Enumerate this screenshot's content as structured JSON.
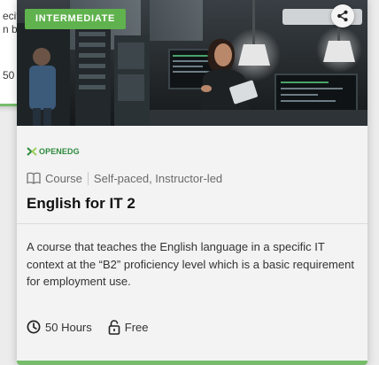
{
  "background_card": {
    "line1": "ecif",
    "line2": "n ba",
    "line3": "50"
  },
  "card": {
    "level_badge": "INTERMEDIATE",
    "share_icon": "share-icon",
    "provider_name": "OPENEDG",
    "course_type": {
      "icon": "book-icon",
      "label": "Course",
      "delivery": "Self-paced, Instructor-led"
    },
    "title": "English for IT 2",
    "description": "A course that teaches the English language in a specific IT context at the “B2” proficiency level which is a basic requirement for employment use.",
    "meta": {
      "duration_icon": "clock-icon",
      "duration": "50 Hours",
      "price_icon": "unlock-icon",
      "price": "Free"
    }
  },
  "colors": {
    "badge": "#5fb24d",
    "accent": "#76bc6b",
    "provider": "#2d8a3c",
    "title_text": "#111111",
    "body_text": "#333333",
    "muted_text": "#6a6a6a"
  }
}
